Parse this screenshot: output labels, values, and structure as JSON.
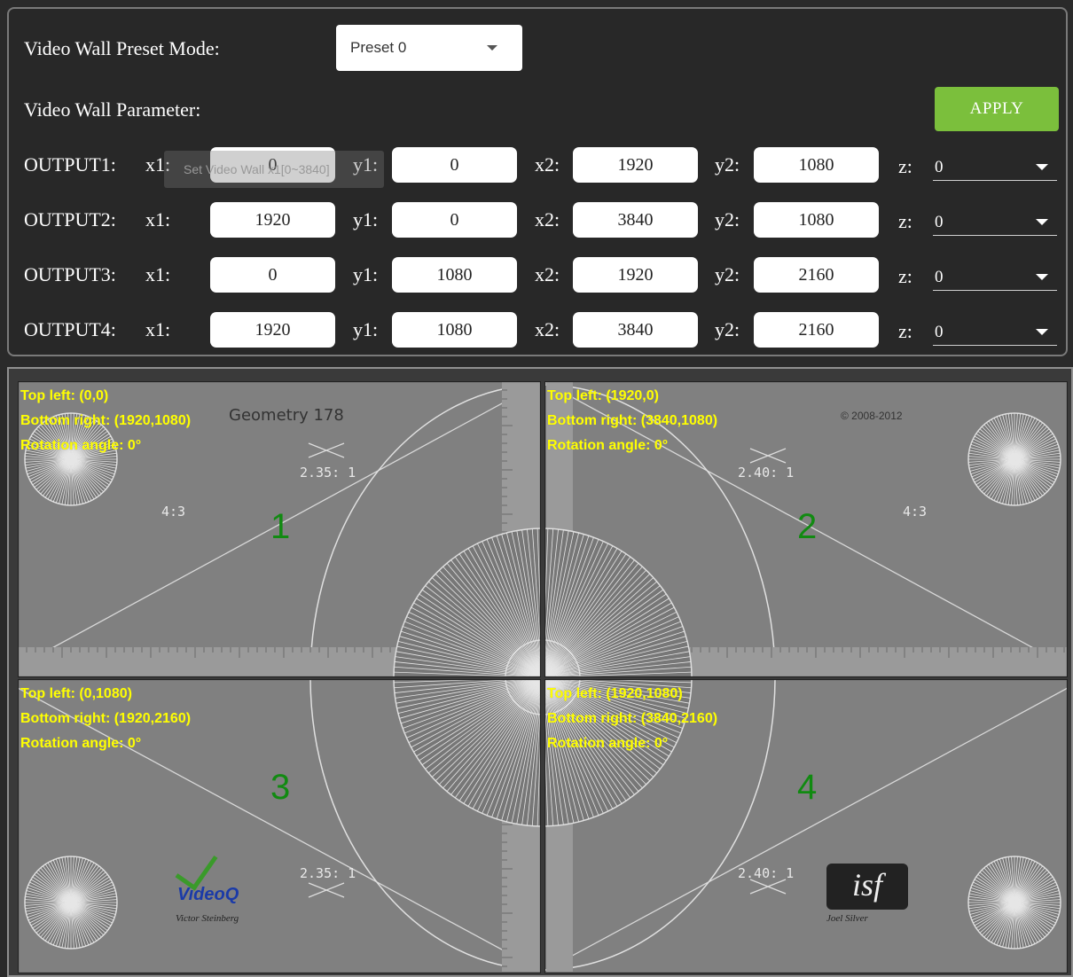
{
  "preset": {
    "label": "Video Wall Preset Mode:",
    "selected": "Preset 0"
  },
  "parameter": {
    "label": "Video Wall Parameter:",
    "apply_label": "APPLY"
  },
  "field_labels": {
    "x1": "x1:",
    "y1": "y1:",
    "x2": "x2:",
    "y2": "y2:",
    "z": "z:"
  },
  "tooltip": "Set Video Wall x1[0~3840]",
  "outputs": [
    {
      "name": "OUTPUT1:",
      "x1": "0",
      "y1": "0",
      "x2": "1920",
      "y2": "1080",
      "z": "0"
    },
    {
      "name": "OUTPUT2:",
      "x1": "1920",
      "y1": "0",
      "x2": "3840",
      "y2": "1080",
      "z": "0"
    },
    {
      "name": "OUTPUT3:",
      "x1": "0",
      "y1": "1080",
      "x2": "1920",
      "y2": "2160",
      "z": "0"
    },
    {
      "name": "OUTPUT4:",
      "x1": "1920",
      "y1": "1080",
      "x2": "3840",
      "y2": "2160",
      "z": "0"
    }
  ],
  "preview": {
    "pattern_title": "Geometry 178",
    "copyright": "© 2008-2012",
    "credit_left": "Victor Steinberg",
    "credit_right": "Joel Silver",
    "logo_left": "VideoQ",
    "logo_right": "isf",
    "tiles": [
      {
        "number": "1",
        "top_left": "Top left: (0,0)",
        "bottom_right": "Bottom right: (1920,1080)",
        "rotation": "Rotation angle: 0°",
        "ratio_a": "2.35: 1",
        "ratio_b": "4:3"
      },
      {
        "number": "2",
        "top_left": "Top left: (1920,0)",
        "bottom_right": "Bottom right: (3840,1080)",
        "rotation": "Rotation angle: 0°",
        "ratio_a": "2.40: 1",
        "ratio_b": "4:3"
      },
      {
        "number": "3",
        "top_left": "Top left: (0,1080)",
        "bottom_right": "Bottom right: (1920,2160)",
        "rotation": "Rotation angle: 0°",
        "ratio_a": "2.35: 1"
      },
      {
        "number": "4",
        "top_left": "Top left: (1920,1080)",
        "bottom_right": "Bottom right: (3840,2160)",
        "rotation": "Rotation angle: 0°",
        "ratio_a": "2.40: 1"
      }
    ]
  },
  "colors": {
    "apply": "#7bbf3c",
    "overlay_text": "#ffff00",
    "tile_number": "#118a11",
    "panel_bg": "#282828",
    "pattern_bg": "#808080"
  }
}
